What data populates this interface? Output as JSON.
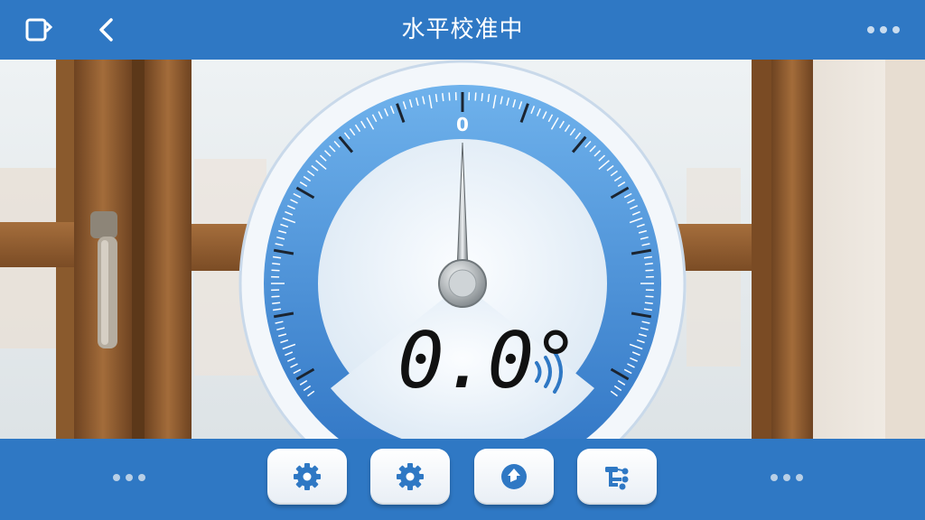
{
  "header": {
    "title": "水平校准中",
    "rotate_icon": "rotate-screen-icon",
    "back_icon": "back-chevron-icon",
    "more_icon": "more-dots-icon"
  },
  "gauge": {
    "scale_top_label": "0",
    "readout": "0.0°",
    "angle_degrees": 0,
    "signal_icon": "signal-waves-icon"
  },
  "footer": {
    "left_dots_icon": "more-dots-icon",
    "right_dots_icon": "more-dots-icon",
    "buttons": [
      {
        "icon": "gear-icon"
      },
      {
        "icon": "gear-icon"
      },
      {
        "icon": "rotate-arrow-icon"
      },
      {
        "icon": "flow-chart-icon"
      }
    ]
  },
  "colors": {
    "bar_blue": "#2f78c4",
    "dial_blue": "#3b86d6",
    "frame_wood": "#8b5a2b"
  }
}
